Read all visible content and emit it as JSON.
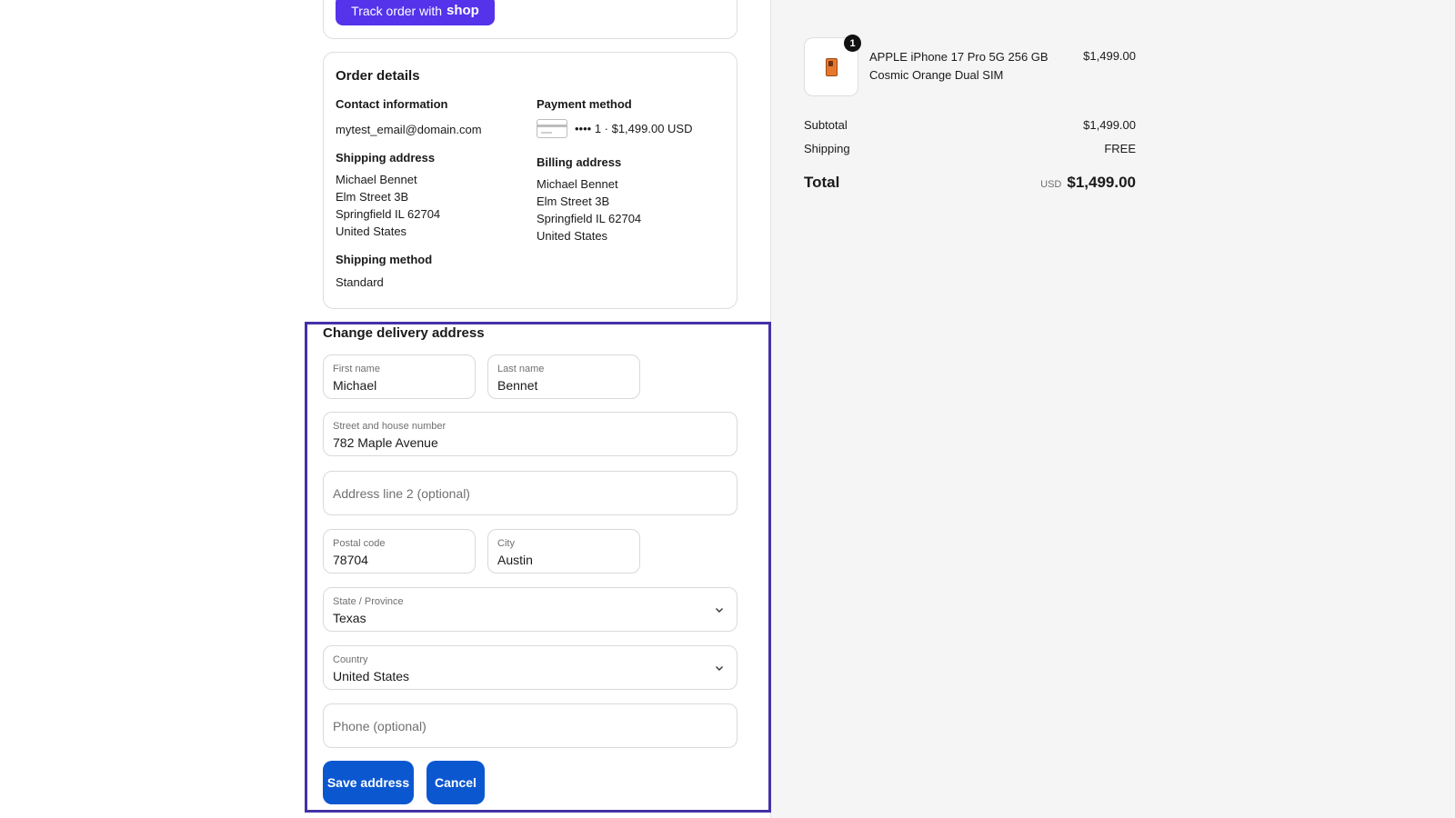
{
  "track": {
    "label": "Track order with",
    "brand": "shop"
  },
  "order_details": {
    "title": "Order details",
    "contact": {
      "heading": "Contact information",
      "email": "mytest_email@domain.com"
    },
    "payment": {
      "heading": "Payment method",
      "summary": "•••• 1 · $1,499.00 USD"
    },
    "shipping_address": {
      "heading": "Shipping address",
      "lines": [
        "Michael Bennet",
        "Elm Street 3B",
        "Springfield IL 62704",
        "United States"
      ]
    },
    "billing_address": {
      "heading": "Billing address",
      "lines": [
        "Michael Bennet",
        "Elm Street 3B",
        "Springfield IL 62704",
        "United States"
      ]
    },
    "shipping_method": {
      "heading": "Shipping method",
      "value": "Standard"
    }
  },
  "delivery_form": {
    "title": "Change delivery address",
    "first_name": {
      "label": "First name",
      "value": "Michael"
    },
    "last_name": {
      "label": "Last name",
      "value": "Bennet"
    },
    "street": {
      "label": "Street and house number",
      "value": "782 Maple Avenue"
    },
    "address2": {
      "placeholder": "Address line 2 (optional)"
    },
    "postal_code": {
      "label": "Postal code",
      "value": "78704"
    },
    "city": {
      "label": "City",
      "value": "Austin"
    },
    "state": {
      "label": "State / Province",
      "value": "Texas"
    },
    "country": {
      "label": "Country",
      "value": "United States"
    },
    "phone": {
      "placeholder": "Phone (optional)"
    },
    "save_label": "Save address",
    "cancel_label": "Cancel"
  },
  "summary": {
    "product": {
      "name": "APPLE iPhone 17 Pro 5G 256 GB Cosmic Orange Dual SIM",
      "price": "$1,499.00",
      "quantity": "1",
      "icon": "phone-icon"
    },
    "subtotal_label": "Subtotal",
    "subtotal_value": "$1,499.00",
    "shipping_label": "Shipping",
    "shipping_value": "FREE",
    "total_label": "Total",
    "currency": "USD",
    "total_value": "$1,499.00"
  },
  "colors": {
    "track_button": "#5433eb",
    "primary_button": "#0b57d0",
    "highlight_frame": "#4432a8",
    "summary_background": "#f5f5f5"
  }
}
